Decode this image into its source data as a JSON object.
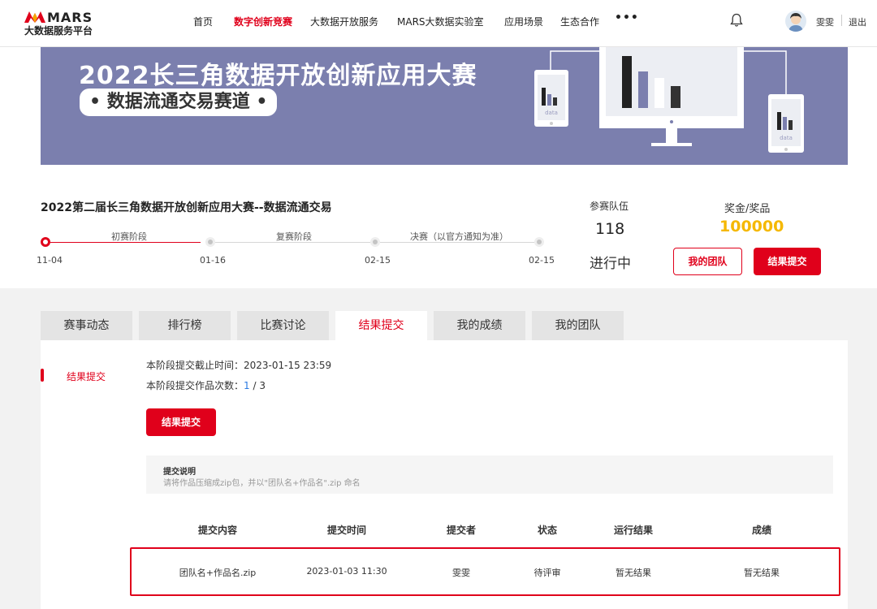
{
  "header": {
    "logo_brand": "MARS",
    "logo_sub": "大数据服务平台",
    "nav": [
      {
        "label": "首页",
        "active": false
      },
      {
        "label": "数字创新竞赛",
        "active": true
      },
      {
        "label": "大数据开放服务",
        "active": false
      },
      {
        "label": "MARS大数据实验室",
        "active": false
      },
      {
        "label": "应用场景",
        "active": false
      },
      {
        "label": "生态合作",
        "active": false
      }
    ],
    "more": "•••",
    "username": "雯雯",
    "logout": "退出",
    "icons": {
      "bell": "bell-icon",
      "avatar": "avatar"
    }
  },
  "banner": {
    "title": "2022长三角数据开放创新应用大赛",
    "tag": "• 数据流通交易赛道 •",
    "art_label": "data"
  },
  "competition": {
    "title": "2022第二届长三角数据开放创新应用大赛--数据流通交易",
    "stages": [
      {
        "label": "初赛阶段"
      },
      {
        "label": "复赛阶段"
      },
      {
        "label": "决赛（以官方通知为准）"
      }
    ],
    "dates": [
      "11-04",
      "01-16",
      "02-15",
      "02-15"
    ],
    "teams_label": "参赛队伍",
    "teams_count": "118",
    "status": "进行中",
    "prize_label": "奖金/奖品",
    "prize_value": "100000",
    "my_team_button": "我的团队",
    "submit_button": "结果提交"
  },
  "tabs": [
    {
      "label": "赛事动态",
      "active": false
    },
    {
      "label": "排行榜",
      "active": false
    },
    {
      "label": "比赛讨论",
      "active": false
    },
    {
      "label": "结果提交",
      "active": true
    },
    {
      "label": "我的成绩",
      "active": false
    },
    {
      "label": "我的团队",
      "active": false
    }
  ],
  "submission": {
    "side_label": "结果提交",
    "deadline": "本阶段提交截止时间：2023-01-15 23:59",
    "count_prefix": "本阶段提交作品次数：",
    "count_used": "1",
    "count_sep": " / ",
    "count_total": "3",
    "submit_button": "结果提交",
    "note_title": "提交说明",
    "note_desc": "请将作品压缩成zip包，并以\"团队名+作品名\".zip 命名",
    "table_headers": [
      "提交内容",
      "提交时间",
      "提交者",
      "状态",
      "运行结果",
      "成绩"
    ],
    "rows": [
      [
        "团队名+作品名.zip",
        "2023-01-03 11:30",
        "雯雯",
        "待评审",
        "暂无结果",
        "暂无结果"
      ]
    ]
  },
  "colors": {
    "accent": "#e0001b",
    "banner_bg": "#7b7fae",
    "prize": "#f5b800",
    "link": "#2a7ae2"
  }
}
